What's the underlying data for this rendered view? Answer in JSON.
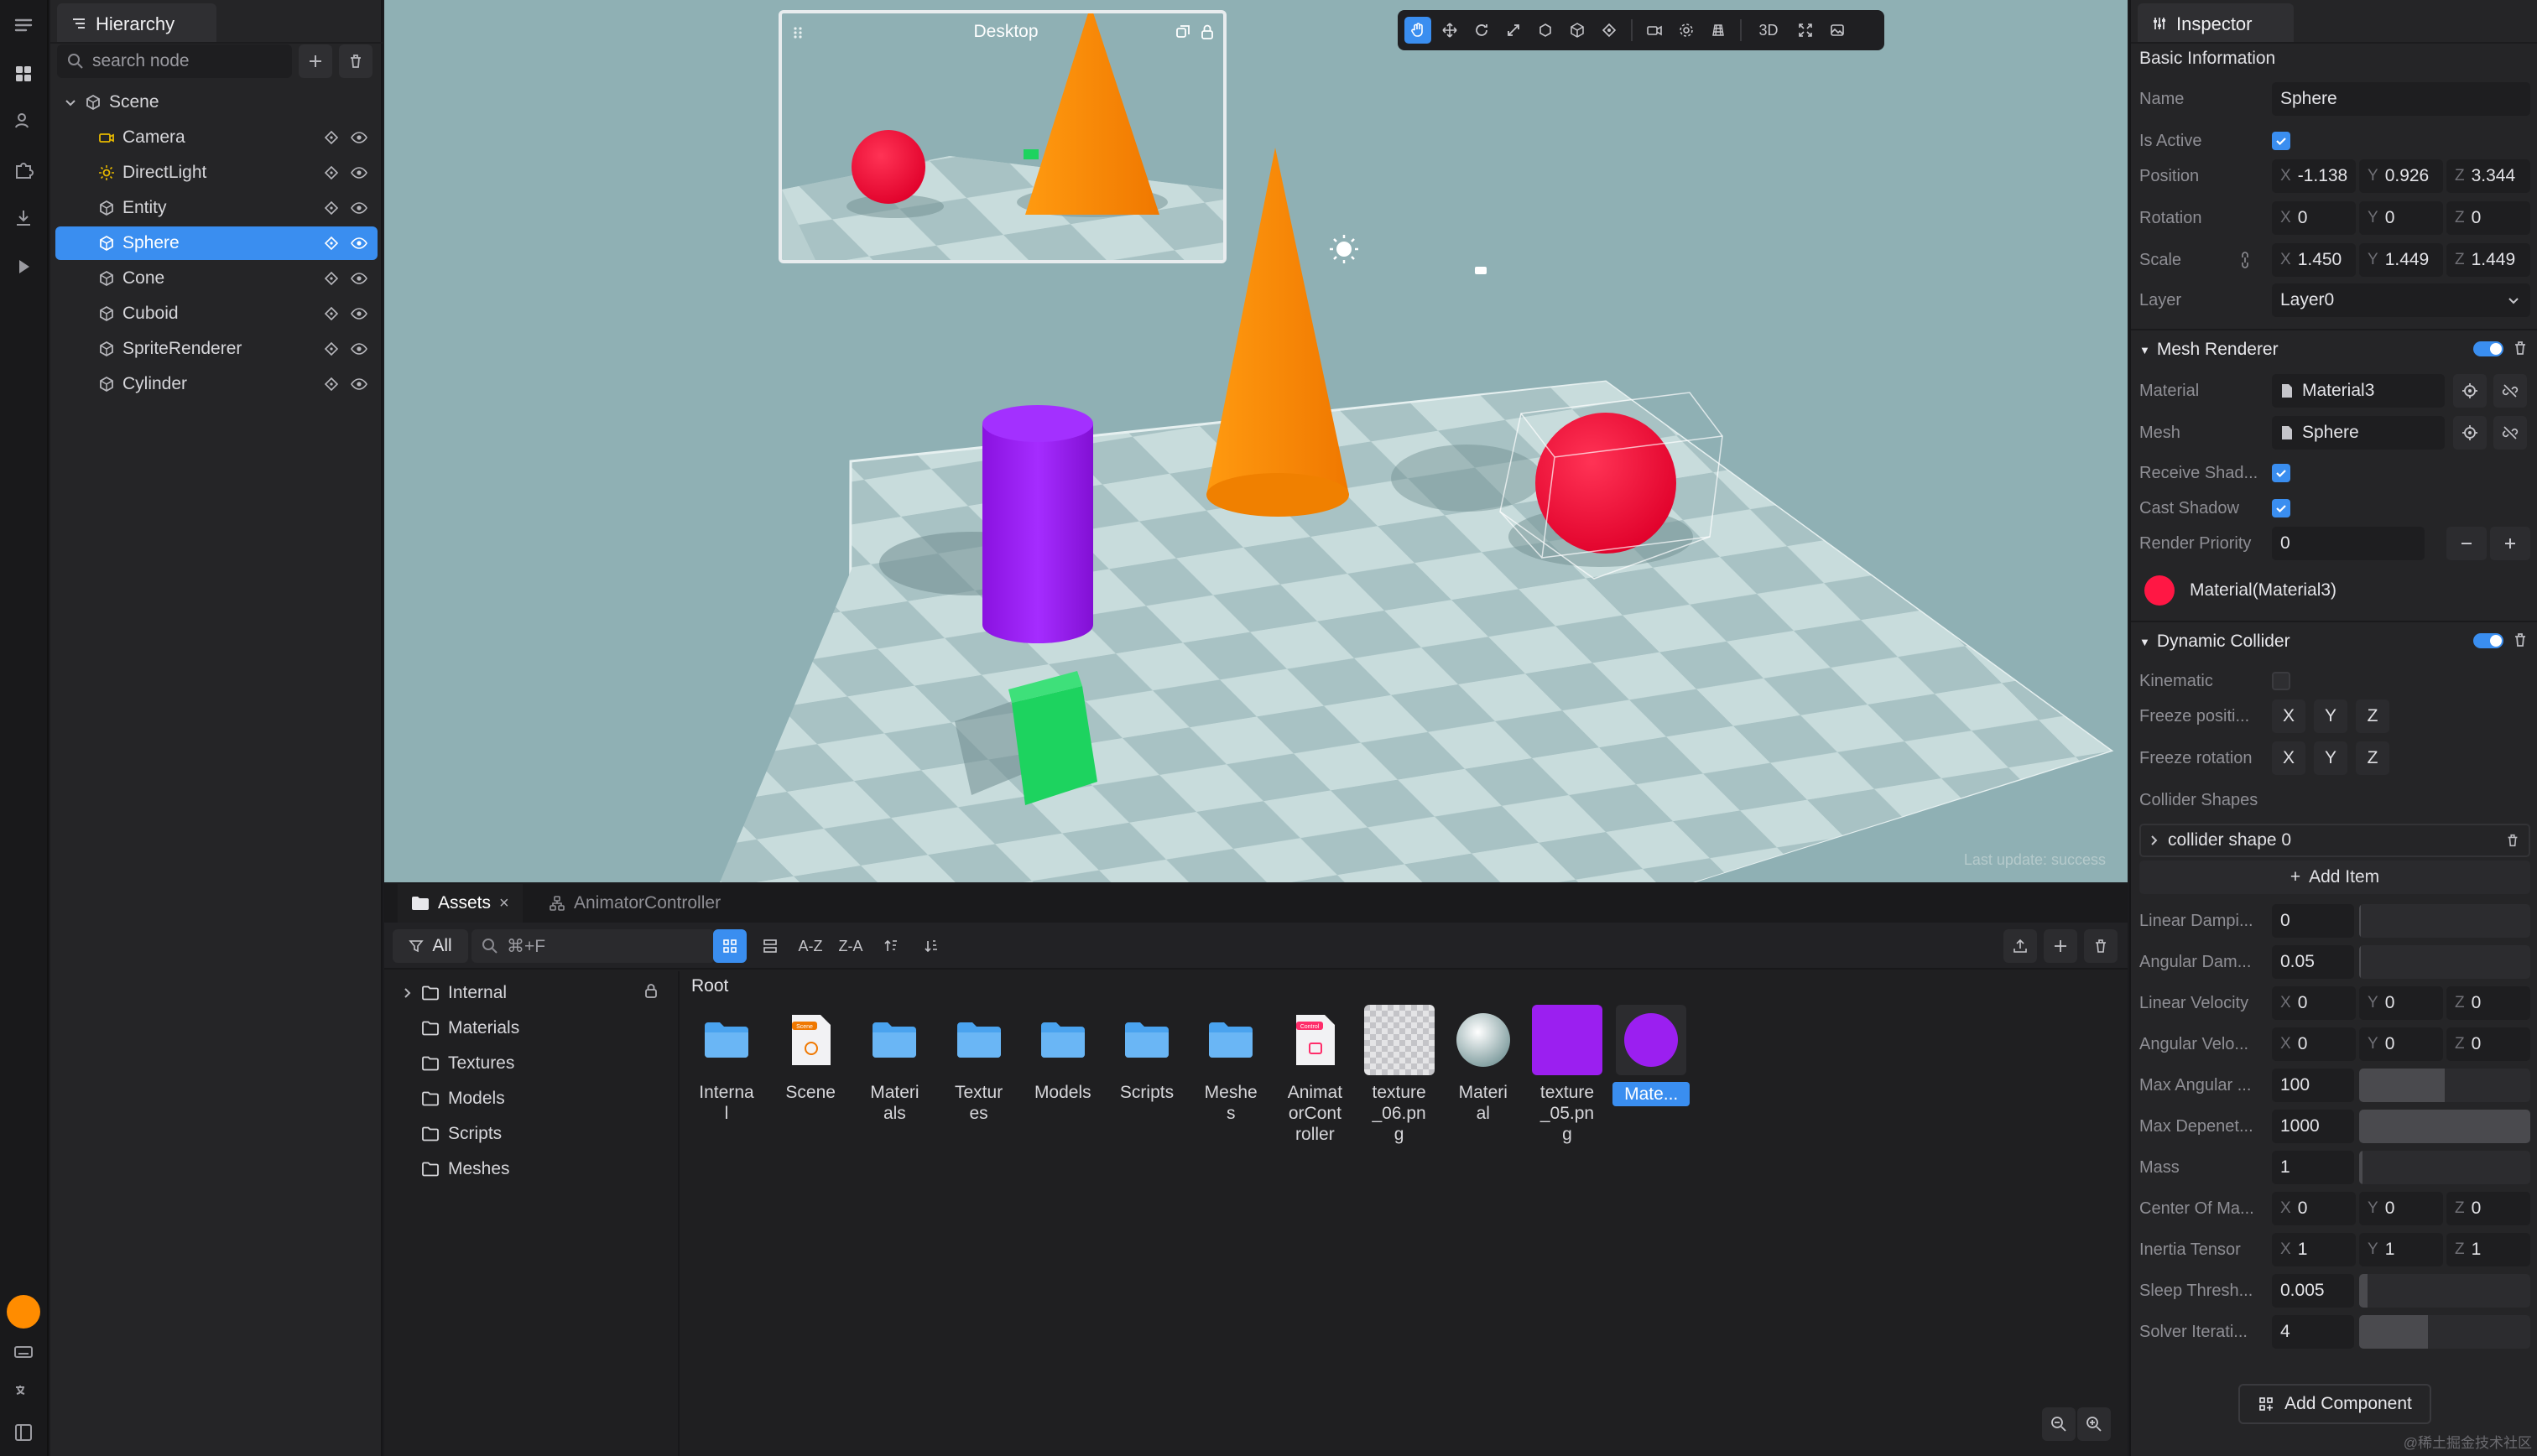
{
  "colors": {
    "accent": "#3a8ef0",
    "sphere": "#ff1744",
    "cone": "#ff8c00",
    "cylinder": "#9b1ff0",
    "cube": "#1dd35f"
  },
  "hierarchy": {
    "tab": "Hierarchy",
    "search_placeholder": "search node",
    "scene": "Scene",
    "nodes": [
      {
        "label": "Camera",
        "icon": "camera-icon"
      },
      {
        "label": "DirectLight",
        "icon": "sun-icon"
      },
      {
        "label": "Entity",
        "icon": "cube-icon"
      },
      {
        "label": "Sphere",
        "icon": "cube-icon",
        "selected": true
      },
      {
        "label": "Cone",
        "icon": "cube-icon"
      },
      {
        "label": "Cuboid",
        "icon": "cube-icon"
      },
      {
        "label": "SpriteRenderer",
        "icon": "cube-icon"
      },
      {
        "label": "Cylinder",
        "icon": "cube-icon"
      }
    ]
  },
  "viewport": {
    "preview_title": "Desktop",
    "mode": "3D",
    "status": "Last update: success"
  },
  "assets": {
    "tab": "Assets",
    "tab2": "AnimatorController",
    "filter": "All",
    "search_placeholder": "⌘+F",
    "sort_az": "A-Z",
    "sort_za": "Z-A",
    "tree": [
      "Internal",
      "Materials",
      "Textures",
      "Models",
      "Scripts",
      "Meshes"
    ],
    "root_label": "Root",
    "items": [
      {
        "label": "Interna\nl",
        "kind": "folder"
      },
      {
        "label": "Scene",
        "kind": "scene"
      },
      {
        "label": "Materi\nals",
        "kind": "folder"
      },
      {
        "label": "Textur\nes",
        "kind": "folder"
      },
      {
        "label": "Models",
        "kind": "folder"
      },
      {
        "label": "Scripts",
        "kind": "folder"
      },
      {
        "label": "Meshe\ns",
        "kind": "folder"
      },
      {
        "label": "Animat\norCont\nroller",
        "kind": "controller"
      },
      {
        "label": "texture\n_06.pn\ng",
        "kind": "checker"
      },
      {
        "label": "Materi\nal",
        "kind": "ball"
      },
      {
        "label": "texture\n_05.pn\ng",
        "kind": "purple"
      },
      {
        "label": "Mate...",
        "kind": "purple-ball",
        "selected": true
      }
    ]
  },
  "inspector": {
    "tab": "Inspector",
    "basic_info": "Basic Information",
    "name_label": "Name",
    "name_value": "Sphere",
    "active_label": "Is Active",
    "position_label": "Position",
    "position": {
      "x": "-1.138",
      "y": "0.926",
      "z": "3.344"
    },
    "rotation_label": "Rotation",
    "rotation": {
      "x": "0",
      "y": "0",
      "z": "0"
    },
    "scale_label": "Scale",
    "scale": {
      "x": "1.450",
      "y": "1.449",
      "z": "1.449"
    },
    "layer_label": "Layer",
    "layer_value": "Layer0",
    "mesh_renderer": {
      "title": "Mesh Renderer",
      "material_label": "Material",
      "material_value": "Material3",
      "mesh_label": "Mesh",
      "mesh_value": "Sphere",
      "receive_label": "Receive Shad...",
      "cast_label": "Cast Shadow",
      "priority_label": "Render Priority",
      "priority_value": "0",
      "material_ref": "Material(Material3)"
    },
    "collider": {
      "title": "Dynamic Collider",
      "kinematic_label": "Kinematic",
      "freeze_pos_label": "Freeze positi...",
      "freeze_rot_label": "Freeze rotation",
      "x": "X",
      "y": "Y",
      "z": "Z",
      "shapes_label": "Collider Shapes",
      "shape0": "collider shape 0",
      "add_item": "Add Item",
      "linear_damp_label": "Linear Dampi...",
      "linear_damp": "0",
      "angular_damp_label": "Angular Dam...",
      "angular_damp": "0.05",
      "lin_vel_label": "Linear Velocity",
      "lin_vel": {
        "x": "0",
        "y": "0",
        "z": "0"
      },
      "ang_vel_label": "Angular Velo...",
      "ang_vel": {
        "x": "0",
        "y": "0",
        "z": "0"
      },
      "max_ang_label": "Max Angular ...",
      "max_ang": "100",
      "max_dep_label": "Max Depenet...",
      "max_dep": "1000",
      "mass_label": "Mass",
      "mass": "1",
      "com_label": "Center Of Ma...",
      "com": {
        "x": "0",
        "y": "0",
        "z": "0"
      },
      "inertia_label": "Inertia Tensor",
      "inertia": {
        "x": "1",
        "y": "1",
        "z": "1"
      },
      "sleep_label": "Sleep Thresh...",
      "sleep": "0.005",
      "solver_label": "Solver Iterati...",
      "solver": "4"
    },
    "add_component": "Add Component"
  },
  "watermark": "@稀土掘金技术社区"
}
